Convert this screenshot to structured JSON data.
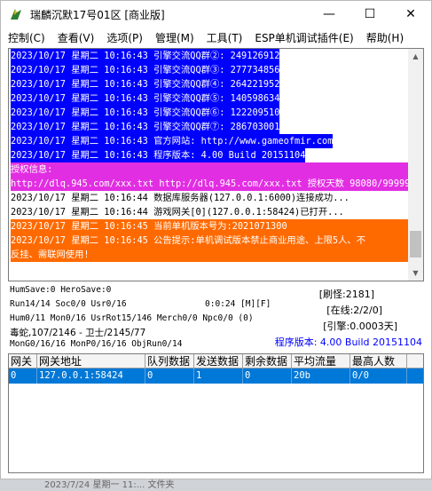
{
  "window": {
    "title": "瑞麟沉默17号01区 [商业版]"
  },
  "titlebar": {
    "minimize_glyph": "—",
    "maximize_glyph": "☐",
    "close_glyph": "✕"
  },
  "menu": [
    "控制(C)",
    "查看(V)",
    "选项(P)",
    "管理(M)",
    "工具(T)",
    "ESP单机调试插件(E)",
    "帮助(H)"
  ],
  "log": {
    "lines": [
      {
        "text": "2023/10/17 星期二 10:16:43 引擎交流QQ群②: 249126912",
        "style": "blue"
      },
      {
        "text": "2023/10/17 星期二 10:16:43 引擎交流QQ群③: 277734856",
        "style": "blue"
      },
      {
        "text": "2023/10/17 星期二 10:16:43 引擎交流QQ群④: 264221952",
        "style": "blue"
      },
      {
        "text": "2023/10/17 星期二 10:16:43 引擎交流QQ群⑤: 140598634",
        "style": "blue"
      },
      {
        "text": "2023/10/17 星期二 10:16:43 引擎交流QQ群⑥: 122209510",
        "style": "blue"
      },
      {
        "text": "2023/10/17 星期二 10:16:43 引擎交流QQ群⑦: 286703001",
        "style": "blue"
      },
      {
        "text": "2023/10/17 星期二 10:16:43 官方网站: http://www.gameofmir.com",
        "style": "blue"
      },
      {
        "text": "2023/10/17 星期二 10:16:43 程序版本: 4.00 Build 20151104",
        "style": "blue"
      },
      {
        "text": "授权信息:",
        "style": "purple"
      },
      {
        "text": "http://dlq.945.com/xxx.txt http://dlq.945.com/xxx.txt 授权天数 98080/99999",
        "style": "purple"
      },
      {
        "text": "2023/10/17 星期二 10:16:44 数据库服务器(127.0.0.1:6000)连接成功...",
        "style": "plain"
      },
      {
        "text": "2023/10/17 星期二 10:16:44 游戏网关[0](127.0.0.1:58424)已打开...",
        "style": "plain"
      },
      {
        "text": "2023/10/17 星期二 10:16:45 当前单机版本号为:2021071300",
        "style": "orange"
      },
      {
        "text": "2023/10/17 星期二 10:16:45 公告提示:单机调试版本禁止商业用途、上限5人、不",
        "style": "orange"
      },
      {
        "text": "反挂、需联网使用!",
        "style": "orange"
      }
    ]
  },
  "status": {
    "line1": "HumSave:0 HeroSave:0",
    "line2_left": "Run14/14 Soc0/0 Usr0/16",
    "line2_mid": "0:0:24 [M][F]",
    "line3": "Hum0/11 Mon0/16 UsrRot15/146 Merch0/0 Npc0/0 (0)",
    "line4": "毒蛇,107/2146 - 卫士/2145/77",
    "line5": "MonG0/16/16 MonP0/16/16 ObjRun0/14",
    "refresh": "[刷怪:2181]",
    "online": "[在线:2/2/0]",
    "engine": "[引擎:0.0003天]",
    "version": "程序版本: 4.00 Build 20151104"
  },
  "grid": {
    "headers": [
      "网关",
      "网关地址",
      "队列数据",
      "发送数据",
      "剩余数据",
      "平均流量",
      "最高人数"
    ],
    "rows": [
      [
        "0",
        "127.0.0.1:58424",
        "0",
        "1",
        "0",
        "20b",
        "0/0"
      ]
    ]
  },
  "taskbar_peek": "2023/7/24 星期一 11:...  文件夹",
  "colors": {
    "log_blue": "#0000ff",
    "log_purple": "#e22ee2",
    "log_orange": "#ff6a00",
    "selection": "#0078d7",
    "version_text": "#0000ff"
  }
}
